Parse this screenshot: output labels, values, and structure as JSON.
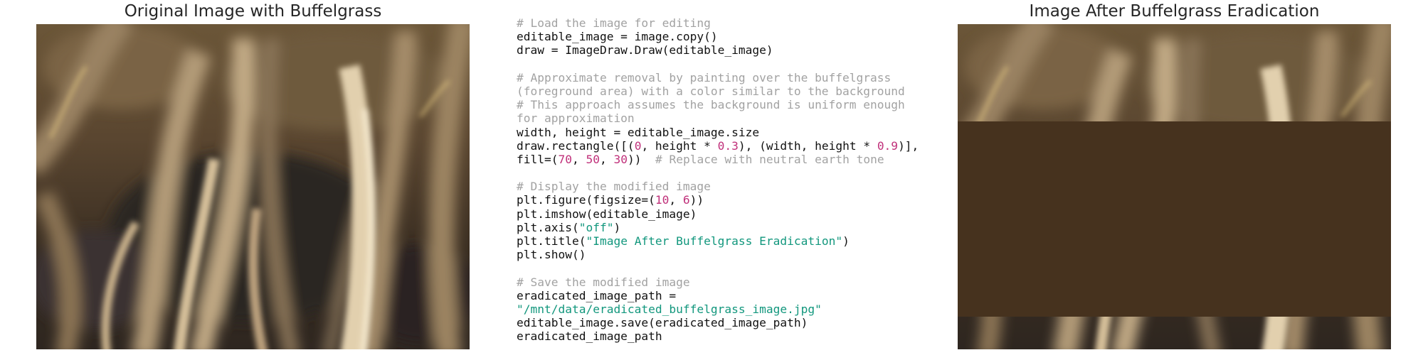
{
  "left_panel": {
    "title": "Original Image with Buffelgrass"
  },
  "right_panel": {
    "title": "Image After Buffelgrass Eradication",
    "fill_color": "#46321e",
    "fill_band": {
      "start_fraction": 0.3,
      "end_fraction": 0.9
    }
  },
  "code": {
    "lines": [
      [
        {
          "t": "# Load the image for editing",
          "k": "c"
        }
      ],
      [
        {
          "t": "editable_image = image.copy()",
          "k": "p"
        }
      ],
      [
        {
          "t": "draw = ImageDraw.Draw(editable_image)",
          "k": "p"
        }
      ],
      [],
      [
        {
          "t": "# Approximate removal by painting over the buffelgrass",
          "k": "c"
        }
      ],
      [
        {
          "t": "(foreground area) with a color similar to the background",
          "k": "c"
        }
      ],
      [
        {
          "t": "# This approach assumes the background is uniform enough",
          "k": "c"
        }
      ],
      [
        {
          "t": "for approximation",
          "k": "c"
        }
      ],
      [
        {
          "t": "width, height = editable_image.size",
          "k": "p"
        }
      ],
      [
        {
          "t": "draw.rectangle([(",
          "k": "p"
        },
        {
          "t": "0",
          "k": "n"
        },
        {
          "t": ", height * ",
          "k": "p"
        },
        {
          "t": "0.3",
          "k": "n"
        },
        {
          "t": "), (width, height * ",
          "k": "p"
        },
        {
          "t": "0.9",
          "k": "n"
        },
        {
          "t": ")],",
          "k": "p"
        }
      ],
      [
        {
          "t": "fill=(",
          "k": "p"
        },
        {
          "t": "70",
          "k": "n"
        },
        {
          "t": ", ",
          "k": "p"
        },
        {
          "t": "50",
          "k": "n"
        },
        {
          "t": ", ",
          "k": "p"
        },
        {
          "t": "30",
          "k": "n"
        },
        {
          "t": "))  ",
          "k": "p"
        },
        {
          "t": "# Replace with neutral earth tone",
          "k": "c"
        }
      ],
      [],
      [
        {
          "t": "# Display the modified image",
          "k": "c"
        }
      ],
      [
        {
          "t": "plt.figure(figsize=(",
          "k": "p"
        },
        {
          "t": "10",
          "k": "n"
        },
        {
          "t": ", ",
          "k": "p"
        },
        {
          "t": "6",
          "k": "n"
        },
        {
          "t": "))",
          "k": "p"
        }
      ],
      [
        {
          "t": "plt.imshow(editable_image)",
          "k": "p"
        }
      ],
      [
        {
          "t": "plt.axis(",
          "k": "p"
        },
        {
          "t": "\"off\"",
          "k": "s"
        },
        {
          "t": ")",
          "k": "p"
        }
      ],
      [
        {
          "t": "plt.title(",
          "k": "p"
        },
        {
          "t": "\"Image After Buffelgrass Eradication\"",
          "k": "s"
        },
        {
          "t": ")",
          "k": "p"
        }
      ],
      [
        {
          "t": "plt.show()",
          "k": "p"
        }
      ],
      [],
      [
        {
          "t": "# Save the modified image",
          "k": "c"
        }
      ],
      [
        {
          "t": "eradicated_image_path =",
          "k": "p"
        }
      ],
      [
        {
          "t": "\"/mnt/data/eradicated_buffelgrass_image.jpg\"",
          "k": "s"
        }
      ],
      [
        {
          "t": "editable_image.save(eradicated_image_path)",
          "k": "p"
        }
      ],
      [
        {
          "t": "eradicated_image_path",
          "k": "p"
        }
      ]
    ]
  }
}
